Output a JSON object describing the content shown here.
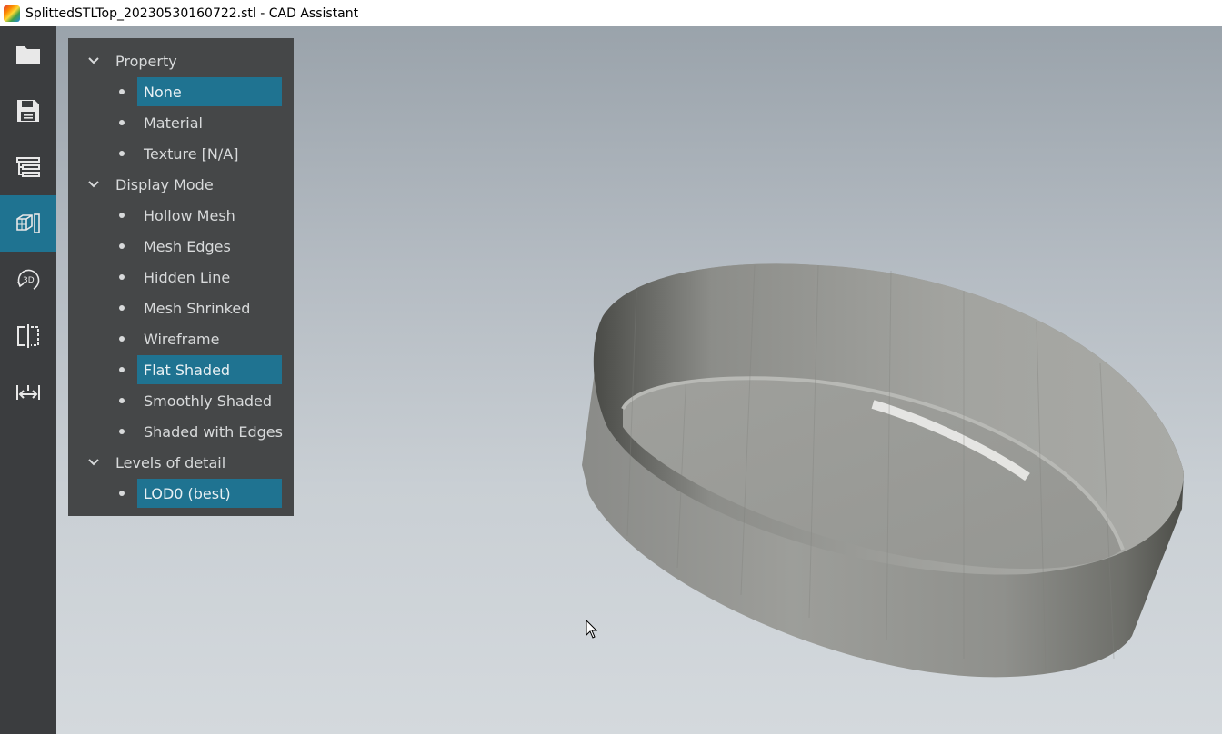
{
  "window": {
    "title": "SplittedSTLTop_20230530160722.stl - CAD Assistant"
  },
  "toolbar": {
    "tools": [
      {
        "icon": "folder-icon"
      },
      {
        "icon": "save-icon"
      },
      {
        "icon": "model-tree-icon"
      },
      {
        "icon": "display-mode-icon",
        "active": true
      },
      {
        "icon": "3d-rotate-icon"
      },
      {
        "icon": "section-plane-icon"
      },
      {
        "icon": "measure-icon"
      }
    ]
  },
  "panel": {
    "sections": [
      {
        "label": "Property",
        "items": [
          {
            "label": "None",
            "selected": true
          },
          {
            "label": "Material",
            "selected": false
          },
          {
            "label": "Texture [N/A]",
            "selected": false
          }
        ]
      },
      {
        "label": "Display Mode",
        "items": [
          {
            "label": "Hollow Mesh",
            "selected": false
          },
          {
            "label": "Mesh Edges",
            "selected": false
          },
          {
            "label": "Hidden Line",
            "selected": false
          },
          {
            "label": "Mesh Shrinked",
            "selected": false
          },
          {
            "label": "Wireframe",
            "selected": false
          },
          {
            "label": "Flat Shaded",
            "selected": true
          },
          {
            "label": "Smoothly Shaded",
            "selected": false
          },
          {
            "label": "Shaded with Edges",
            "selected": false
          }
        ]
      },
      {
        "label": "Levels of detail",
        "items": [
          {
            "label": "LOD0 (best)",
            "selected": true
          }
        ]
      }
    ]
  },
  "colors": {
    "accent": "#1f7391",
    "toolbar_bg": "#3b3d3f",
    "panel_bg": "#454748"
  }
}
